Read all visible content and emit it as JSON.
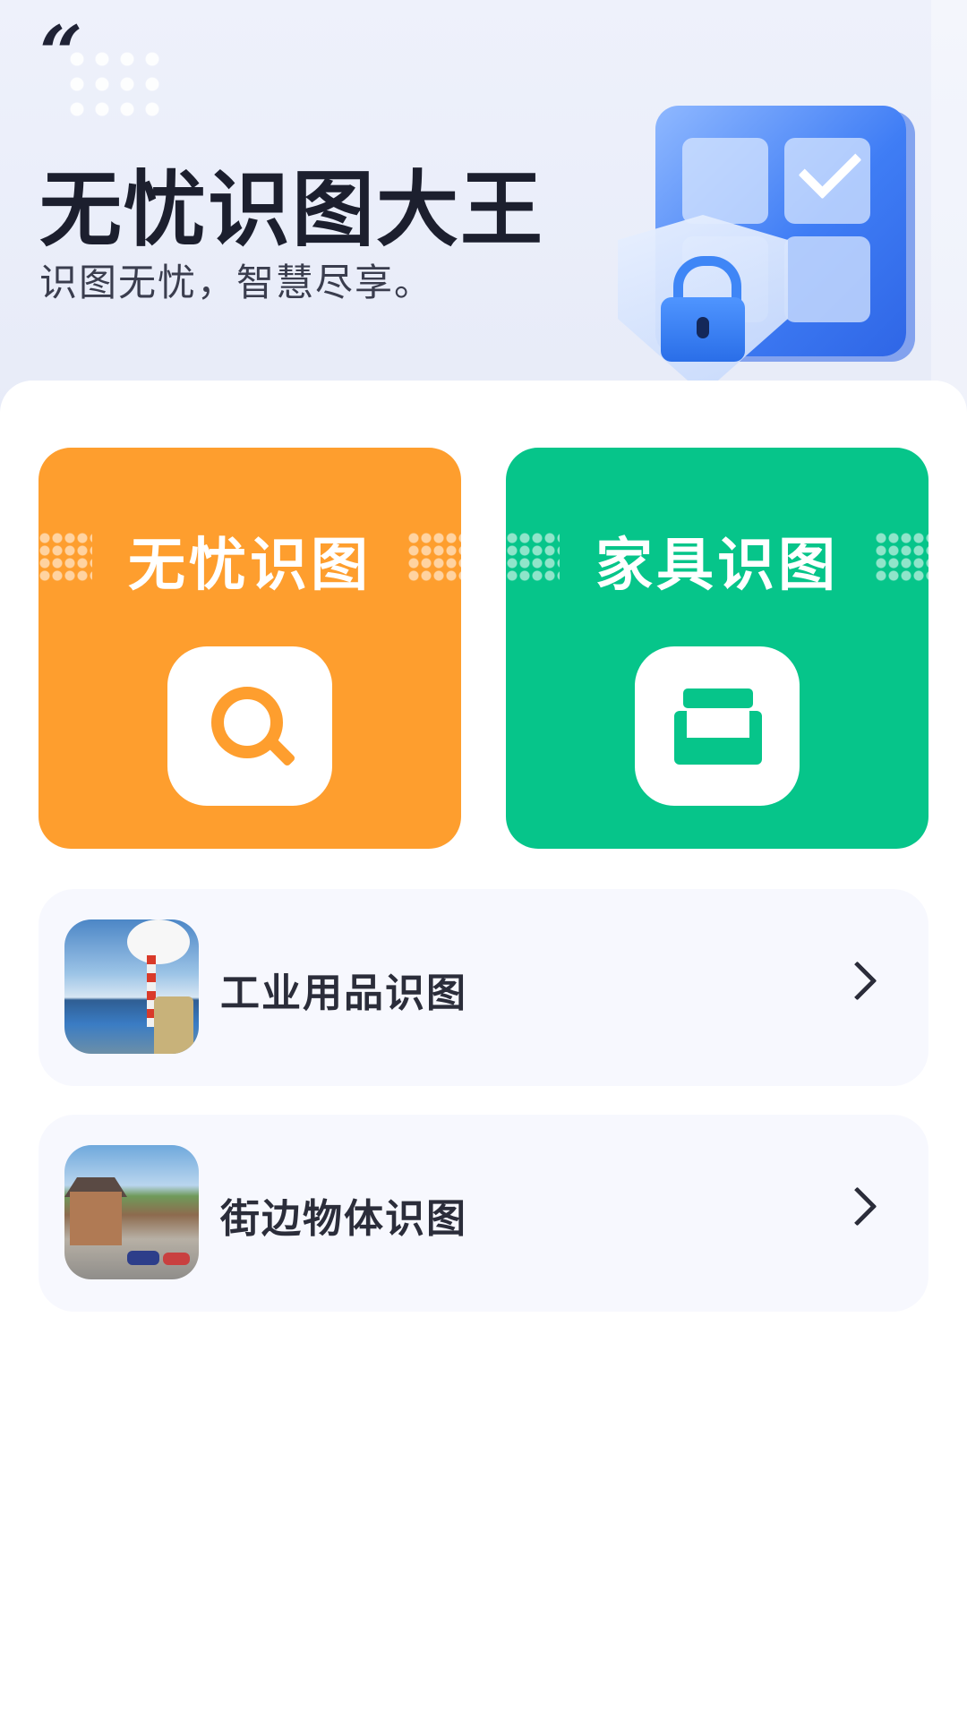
{
  "header": {
    "title": "无忧识图大王",
    "subtitle": "识图无忧，智慧尽享。"
  },
  "features": [
    {
      "label": "无忧识图",
      "icon": "search-icon",
      "color": "#fe9e2e"
    },
    {
      "label": "家具识图",
      "icon": "sofa-icon",
      "color": "#06c58a"
    }
  ],
  "list": [
    {
      "label": "工业用品识图",
      "thumb": "industrial-plant-image"
    },
    {
      "label": "街边物体识图",
      "thumb": "street-scene-image"
    }
  ],
  "colors": {
    "orange": "#fe9e2e",
    "green": "#06c58a",
    "title_text": "#1c1f2e",
    "list_bg": "#f7f8fe"
  }
}
